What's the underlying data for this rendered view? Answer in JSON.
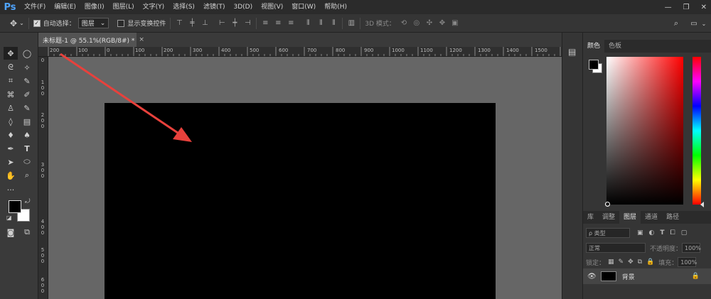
{
  "app": {
    "logo": "Ps"
  },
  "menu": [
    "文件(F)",
    "编辑(E)",
    "图像(I)",
    "图层(L)",
    "文字(Y)",
    "选择(S)",
    "滤镜(T)",
    "3D(D)",
    "视图(V)",
    "窗口(W)",
    "帮助(H)"
  ],
  "window_controls": {
    "minimize": "—",
    "restore": "❐",
    "close": "✕"
  },
  "options": {
    "auto_select_label": "自动选择：",
    "auto_select_checked": true,
    "target_value": "图层",
    "show_transform_label": "显示变换控件",
    "show_transform_checked": false,
    "mode_3d_label": "3D 模式："
  },
  "document": {
    "tab_title": "未标题-1 @ 55.1%(RGB/8#) *",
    "close": "×"
  },
  "ruler": {
    "h_ticks": [
      "200",
      "100",
      "0",
      "100",
      "200",
      "300",
      "400",
      "500",
      "600",
      "700",
      "800",
      "900",
      "1000",
      "1100",
      "1200",
      "1300",
      "1400",
      "1500"
    ],
    "v_ticks": [
      "0",
      "1\n0\n0",
      "2\n0\n0",
      "3\n0\n0",
      "4\n0\n0",
      "5\n0\n0",
      "6\n0\n0"
    ]
  },
  "panels": {
    "color_tabs": [
      "颜色",
      "色板"
    ],
    "layer_tabs": [
      "库",
      "调整",
      "图层",
      "通道",
      "路径"
    ],
    "kind_filter": "ρ 类型",
    "blend_mode": "正常",
    "opacity_label": "不透明度：",
    "opacity_value": "100%",
    "lock_label": "锁定：",
    "fill_label": "填充：",
    "fill_value": "100%",
    "layer_name": "背景"
  },
  "colors": {
    "foreground": "#000000",
    "background": "#ffffff",
    "accent": "#4fa4ff",
    "annotation": "#e8413c"
  }
}
